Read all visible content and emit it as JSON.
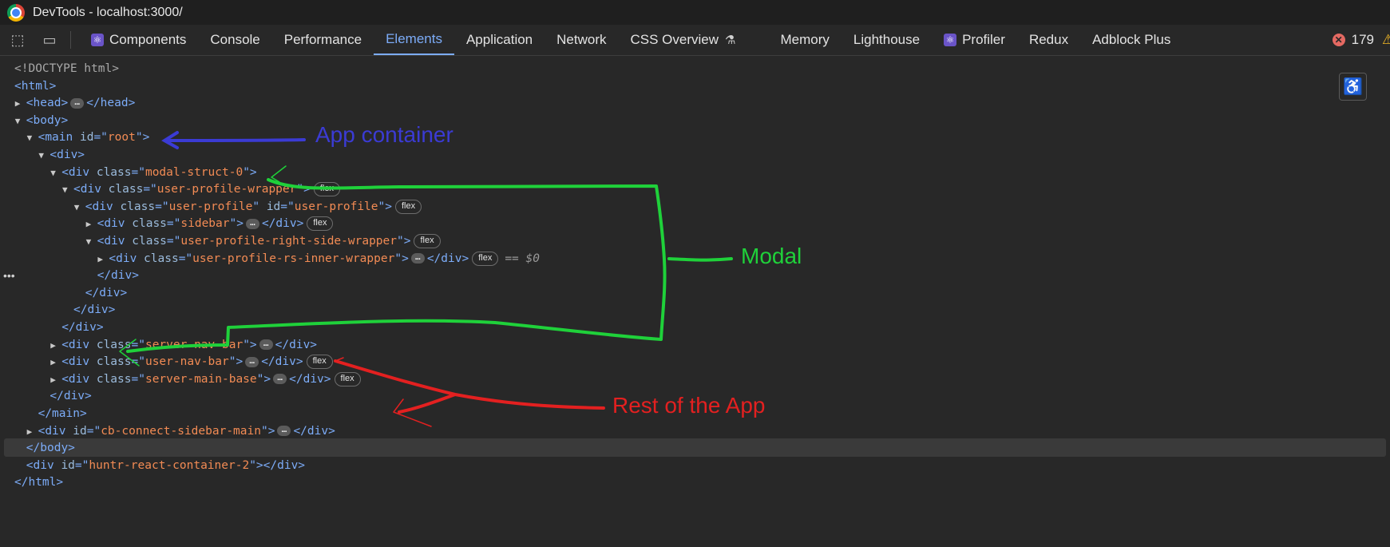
{
  "window": {
    "title": "DevTools - localhost:3000/"
  },
  "toolbar": {
    "tabs": [
      {
        "label": "Components",
        "react": true
      },
      {
        "label": "Console"
      },
      {
        "label": "Performance"
      },
      {
        "label": "Elements",
        "active": true
      },
      {
        "label": "Application"
      },
      {
        "label": "Network"
      },
      {
        "label": "CSS Overview",
        "flask": true
      },
      {
        "label": "Memory"
      },
      {
        "label": "Lighthouse"
      },
      {
        "label": "Profiler",
        "react": true
      },
      {
        "label": "Redux"
      },
      {
        "label": "Adblock Plus"
      }
    ],
    "error_count": "179"
  },
  "tree": {
    "lines": [
      {
        "depth": 0,
        "parts": [
          [
            "doc",
            "<!DOCTYPE html>"
          ]
        ]
      },
      {
        "depth": 0,
        "parts": [
          [
            "tag",
            "<html>"
          ]
        ]
      },
      {
        "depth": 1,
        "tri": "▶",
        "parts": [
          [
            "tag",
            "<head>"
          ],
          [
            "ell",
            "…"
          ],
          [
            "tag",
            "</head>"
          ]
        ]
      },
      {
        "depth": 1,
        "tri": "▼",
        "parts": [
          [
            "tag",
            "<body>"
          ]
        ]
      },
      {
        "depth": 2,
        "tri": "▼",
        "parts": [
          [
            "tag",
            "<main "
          ],
          [
            "attr",
            "id"
          ],
          [
            "tag",
            "=\""
          ],
          [
            "val",
            "root"
          ],
          [
            "tag",
            "\">"
          ]
        ]
      },
      {
        "depth": 3,
        "tri": "▼",
        "parts": [
          [
            "tag",
            "<div>"
          ]
        ]
      },
      {
        "depth": 4,
        "tri": "▼",
        "parts": [
          [
            "tag",
            "<div "
          ],
          [
            "attr",
            "class"
          ],
          [
            "tag",
            "=\""
          ],
          [
            "val",
            "modal-struct-0"
          ],
          [
            "tag",
            "\">"
          ]
        ]
      },
      {
        "depth": 5,
        "tri": "▼",
        "parts": [
          [
            "tag",
            "<div "
          ],
          [
            "attr",
            "class"
          ],
          [
            "tag",
            "=\""
          ],
          [
            "val",
            "user-profile-wrapper"
          ],
          [
            "tag",
            "\">"
          ],
          [
            "badge",
            "flex"
          ]
        ]
      },
      {
        "depth": 6,
        "tri": "▼",
        "parts": [
          [
            "tag",
            "<div "
          ],
          [
            "attr",
            "class"
          ],
          [
            "tag",
            "=\""
          ],
          [
            "val",
            "user-profile"
          ],
          [
            "tag",
            "\" "
          ],
          [
            "attr",
            "id"
          ],
          [
            "tag",
            "=\""
          ],
          [
            "val",
            "user-profile"
          ],
          [
            "tag",
            "\">"
          ],
          [
            "badge",
            "flex"
          ]
        ]
      },
      {
        "depth": 7,
        "tri": "▶",
        "parts": [
          [
            "tag",
            "<div "
          ],
          [
            "attr",
            "class"
          ],
          [
            "tag",
            "=\""
          ],
          [
            "val",
            "sidebar"
          ],
          [
            "tag",
            "\">"
          ],
          [
            "ell",
            "…"
          ],
          [
            "tag",
            "</div>"
          ],
          [
            "badge",
            "flex"
          ]
        ]
      },
      {
        "depth": 7,
        "tri": "▼",
        "parts": [
          [
            "tag",
            "<div "
          ],
          [
            "attr",
            "class"
          ],
          [
            "tag",
            "=\""
          ],
          [
            "val",
            "user-profile-right-side-wrapper"
          ],
          [
            "tag",
            "\">"
          ],
          [
            "badge",
            "flex"
          ]
        ]
      },
      {
        "depth": 8,
        "tri": "▶",
        "parts": [
          [
            "tag",
            "<div "
          ],
          [
            "attr",
            "class"
          ],
          [
            "tag",
            "=\""
          ],
          [
            "val",
            "user-profile-rs-inner-wrapper"
          ],
          [
            "tag",
            "\">"
          ],
          [
            "ell",
            "…"
          ],
          [
            "tag",
            "</div>"
          ],
          [
            "badge",
            "flex"
          ],
          [
            "dollar",
            "== $0"
          ]
        ]
      },
      {
        "depth": 7,
        "parts": [
          [
            "tag",
            "</div>"
          ]
        ]
      },
      {
        "depth": 6,
        "parts": [
          [
            "tag",
            "</div>"
          ]
        ]
      },
      {
        "depth": 5,
        "parts": [
          [
            "tag",
            "</div>"
          ]
        ]
      },
      {
        "depth": 4,
        "parts": [
          [
            "tag",
            "</div>"
          ]
        ]
      },
      {
        "depth": 4,
        "tri": "▶",
        "parts": [
          [
            "tag",
            "<div "
          ],
          [
            "attr",
            "class"
          ],
          [
            "tag",
            "=\""
          ],
          [
            "val",
            "server-nav-bar"
          ],
          [
            "tag",
            "\">"
          ],
          [
            "ell",
            "…"
          ],
          [
            "tag",
            "</div>"
          ]
        ]
      },
      {
        "depth": 4,
        "tri": "▶",
        "parts": [
          [
            "tag",
            "<div "
          ],
          [
            "attr",
            "class"
          ],
          [
            "tag",
            "=\""
          ],
          [
            "val",
            "user-nav-bar"
          ],
          [
            "tag",
            "\">"
          ],
          [
            "ell",
            "…"
          ],
          [
            "tag",
            "</div>"
          ],
          [
            "badge",
            "flex"
          ]
        ]
      },
      {
        "depth": 4,
        "tri": "▶",
        "parts": [
          [
            "tag",
            "<div "
          ],
          [
            "attr",
            "class"
          ],
          [
            "tag",
            "=\""
          ],
          [
            "val",
            "server-main-base"
          ],
          [
            "tag",
            "\">"
          ],
          [
            "ell",
            "…"
          ],
          [
            "tag",
            "</div>"
          ],
          [
            "badge",
            "flex"
          ]
        ]
      },
      {
        "depth": 3,
        "parts": [
          [
            "tag",
            "</div>"
          ]
        ]
      },
      {
        "depth": 2,
        "parts": [
          [
            "tag",
            "</main>"
          ]
        ]
      },
      {
        "depth": 2,
        "tri": "▶",
        "parts": [
          [
            "tag",
            "<div "
          ],
          [
            "attr",
            "id"
          ],
          [
            "tag",
            "=\""
          ],
          [
            "val",
            "cb-connect-sidebar-main"
          ],
          [
            "tag",
            "\">"
          ],
          [
            "ell",
            "…"
          ],
          [
            "tag",
            "</div>"
          ]
        ]
      },
      {
        "depth": 1,
        "parts": [
          [
            "tag",
            "</body>"
          ]
        ]
      },
      {
        "depth": 1,
        "parts": [
          [
            "tag",
            "<div "
          ],
          [
            "attr",
            "id"
          ],
          [
            "tag",
            "=\""
          ],
          [
            "val",
            "huntr-react-container-2"
          ],
          [
            "tag",
            "\">"
          ],
          [
            "tag",
            "</div>"
          ]
        ]
      },
      {
        "depth": 0,
        "parts": [
          [
            "tag",
            "</html>"
          ]
        ]
      }
    ]
  },
  "annotations": {
    "app_container": {
      "label": "App container",
      "color": "#3b3bd4"
    },
    "modal": {
      "label": "Modal",
      "color": "#1fd13a"
    },
    "rest_of_app": {
      "label": "Rest of the App",
      "color": "#e32020"
    }
  }
}
